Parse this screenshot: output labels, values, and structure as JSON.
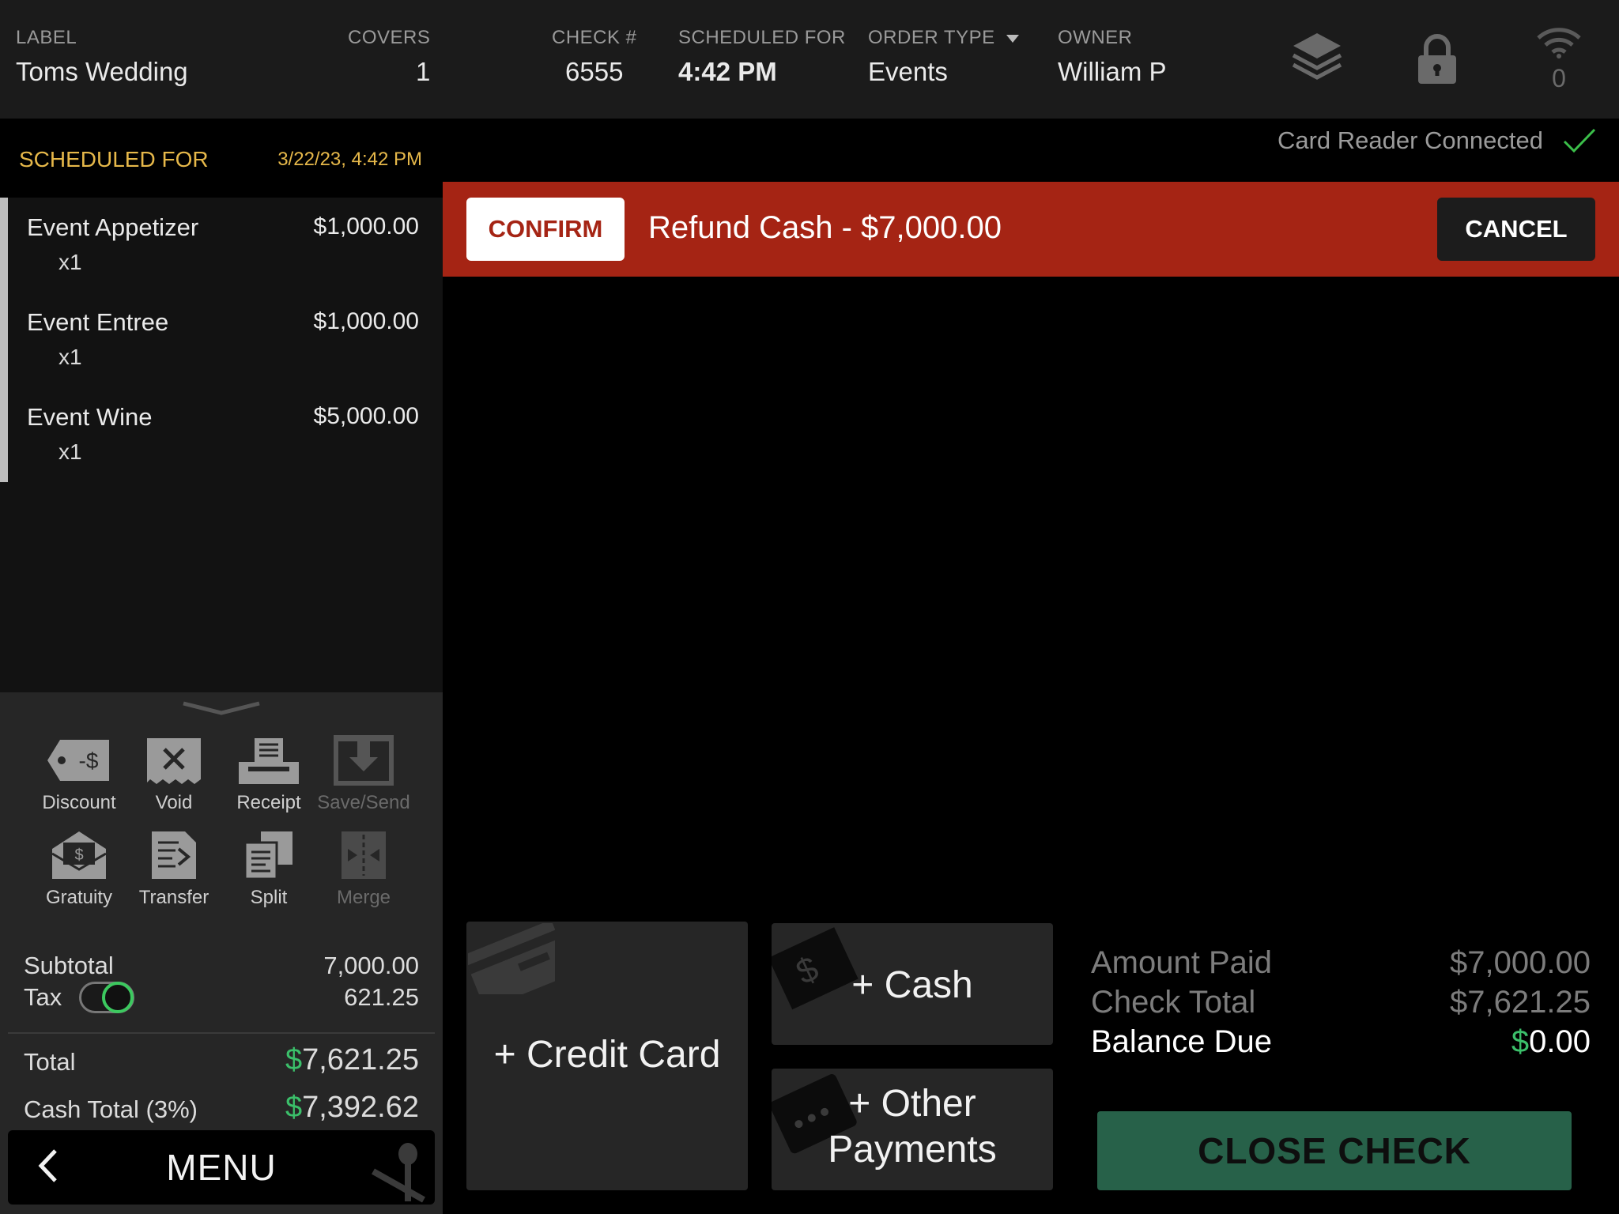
{
  "header": {
    "label_title": "LABEL",
    "label_value": "Toms Wedding",
    "covers_title": "COVERS",
    "covers_value": "1",
    "check_title": "CHECK #",
    "check_value": "6555",
    "scheduled_title": "SCHEDULED FOR",
    "scheduled_value": "4:42 PM",
    "order_type_title": "ORDER TYPE",
    "order_type_value": "Events",
    "owner_title": "OWNER",
    "owner_value": "William P",
    "wifi_count": "0",
    "icons": [
      "layers-icon",
      "lock-icon",
      "wifi-icon"
    ]
  },
  "schedule": {
    "label": "SCHEDULED FOR",
    "date": "3/22/23, 4:42 PM"
  },
  "card_reader": {
    "status": "Card Reader Connected",
    "icon": "check-icon"
  },
  "order_items": [
    {
      "name": "Event Appetizer",
      "qty": "x1",
      "price": "$1,000.00"
    },
    {
      "name": "Event Entree",
      "qty": "x1",
      "price": "$1,000.00"
    },
    {
      "name": "Event Wine",
      "qty": "x1",
      "price": "$5,000.00"
    }
  ],
  "actions": {
    "discount": "Discount",
    "void": "Void",
    "receipt": "Receipt",
    "save_send": "Save/Send",
    "gratuity": "Gratuity",
    "transfer": "Transfer",
    "split": "Split",
    "merge": "Merge"
  },
  "totals": {
    "subtotal_label": "Subtotal",
    "subtotal_value": "7,000.00",
    "tax_label": "Tax",
    "tax_value": "621.25",
    "tax_enabled": true,
    "total_label": "Total",
    "total_symbol": "$",
    "total_value": "7,621.25",
    "cash_total_label": "Cash Total (3%)",
    "cash_total_symbol": "$",
    "cash_total_value": "7,392.62"
  },
  "menu": {
    "label": "MENU"
  },
  "confirm_bar": {
    "confirm_label": "CONFIRM",
    "message": "Refund Cash - $7,000.00",
    "cancel_label": "CANCEL",
    "color": "#a52414"
  },
  "payments": {
    "credit_card": "+ Credit Card",
    "cash": "+ Cash",
    "other_line1": "+ Other",
    "other_line2": "Payments"
  },
  "summary": {
    "amount_paid_label": "Amount Paid",
    "amount_paid_value": "$7,000.00",
    "check_total_label": "Check Total",
    "check_total_value": "$7,621.25",
    "balance_due_label": "Balance Due",
    "balance_due_symbol": "$",
    "balance_due_value": "0.00"
  },
  "close_check": {
    "label": "CLOSE CHECK",
    "color": "#276149"
  }
}
